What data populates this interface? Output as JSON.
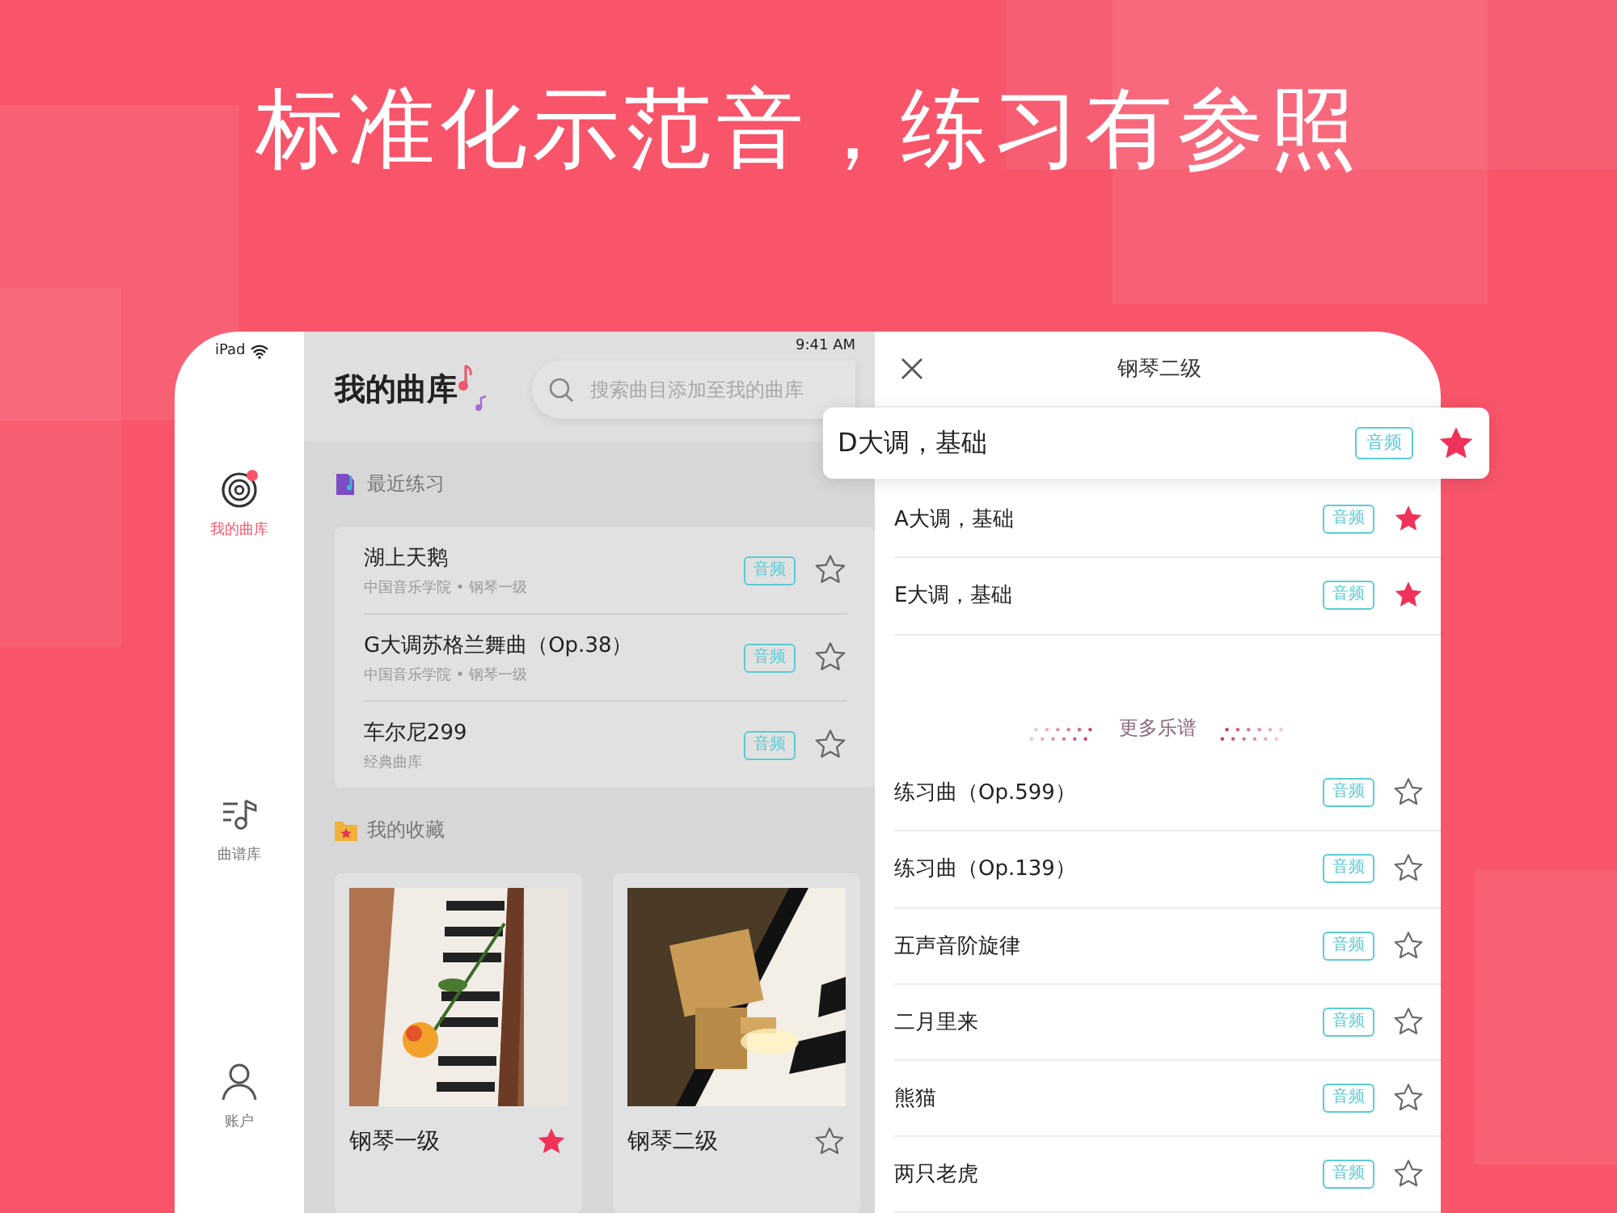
{
  "headline": "标准化示范音，练习有参照",
  "status_bar": {
    "device": "iPad",
    "time": "9:41 AM"
  },
  "nav": [
    {
      "label": "我的曲库",
      "kind": "library",
      "selected": true
    },
    {
      "label": "曲谱库",
      "kind": "scores",
      "selected": false
    },
    {
      "label": "账户",
      "kind": "account",
      "selected": false
    }
  ],
  "library": {
    "title": "我的曲库",
    "search": {
      "placeholder": "搜索曲目添加至我的曲库"
    },
    "recent": {
      "title": "最近练习",
      "items": [
        {
          "title": "湖上天鹅",
          "subtitle": "中国音乐学院 • 钢琴一级",
          "tag": "音频",
          "starred": false
        },
        {
          "title": "G大调苏格兰舞曲（Op.38）",
          "subtitle": "中国音乐学院 • 钢琴一级",
          "tag": "音频",
          "starred": false
        },
        {
          "title": "车尔尼299",
          "subtitle": "经典曲库",
          "tag": "音频",
          "starred": false
        }
      ]
    },
    "favorites": {
      "title": "我的收藏",
      "items": [
        {
          "title": "钢琴一级",
          "starred": true,
          "kind": "picture"
        },
        {
          "title": "钢琴二级",
          "starred": false,
          "kind": "picture"
        }
      ]
    }
  },
  "panel": {
    "title": "钢琴二级",
    "featured": [
      {
        "title": "D大调，基础",
        "tag": "音频",
        "starred": true,
        "raised": true
      },
      {
        "title": "A大调，基础",
        "tag": "音频",
        "starred": true,
        "raised": false
      },
      {
        "title": "E大调，基础",
        "tag": "音频",
        "starred": true,
        "raised": false
      }
    ],
    "more": "更多乐谱",
    "scores": [
      {
        "title": "练习曲（Op.599）",
        "tag": "音频",
        "starred": false
      },
      {
        "title": "练习曲（Op.139）",
        "tag": "音频",
        "starred": false
      },
      {
        "title": "五声音阶旋律",
        "tag": "音频",
        "starred": false
      },
      {
        "title": "二月里来",
        "tag": "音频",
        "starred": false
      },
      {
        "title": "熊猫",
        "tag": "音频",
        "starred": false
      },
      {
        "title": "两只老虎",
        "tag": "音频",
        "starred": false
      }
    ]
  }
}
